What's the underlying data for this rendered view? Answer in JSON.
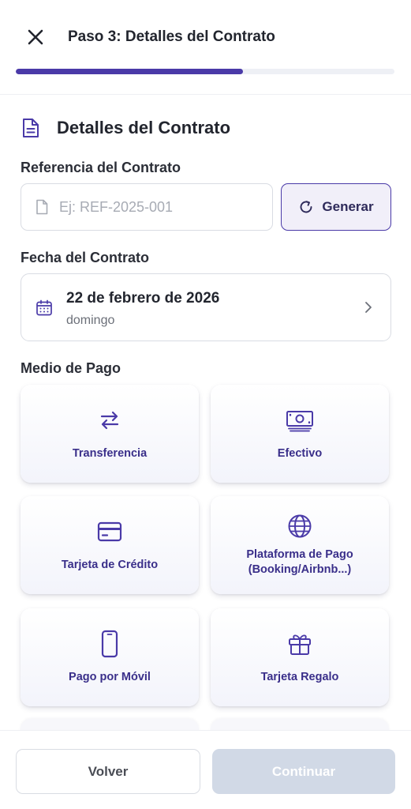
{
  "header": {
    "title": "Paso 3: Detalles del Contrato",
    "close_icon": "close-icon",
    "progress_fraction": 0.6
  },
  "section": {
    "icon": "document-icon",
    "title": "Detalles del Contrato"
  },
  "reference": {
    "label": "Referencia del Contrato",
    "placeholder": "Ej: REF-2025-001",
    "value": "",
    "input_icon": "file-icon",
    "generate_icon": "refresh-icon",
    "generate_label": "Generar"
  },
  "date": {
    "label": "Fecha del Contrato",
    "icon": "calendar-icon",
    "value": "22 de febrero de 2026",
    "weekday": "domingo",
    "chevron_icon": "chevron-right-icon"
  },
  "payment": {
    "label": "Medio de Pago",
    "options": [
      {
        "label": "Transferencia",
        "icon": "transfer-arrows-icon"
      },
      {
        "label": "Efectivo",
        "icon": "cash-icon"
      },
      {
        "label": "Tarjeta de Crédito",
        "icon": "credit-card-icon"
      },
      {
        "label": "Plataforma de Pago\n(Booking/Airbnb...)",
        "icon": "globe-icon"
      },
      {
        "label": "Pago por Móvil",
        "icon": "mobile-phone-icon"
      },
      {
        "label": "Tarjeta Regalo",
        "icon": "gift-icon"
      }
    ]
  },
  "footer": {
    "back_label": "Volver",
    "next_label": "Continuar"
  },
  "colors": {
    "accent": "#4a3aa8",
    "accent_text": "#3a2f8a",
    "disabled_button": "#d1d9e6",
    "border": "#d9dce3"
  }
}
